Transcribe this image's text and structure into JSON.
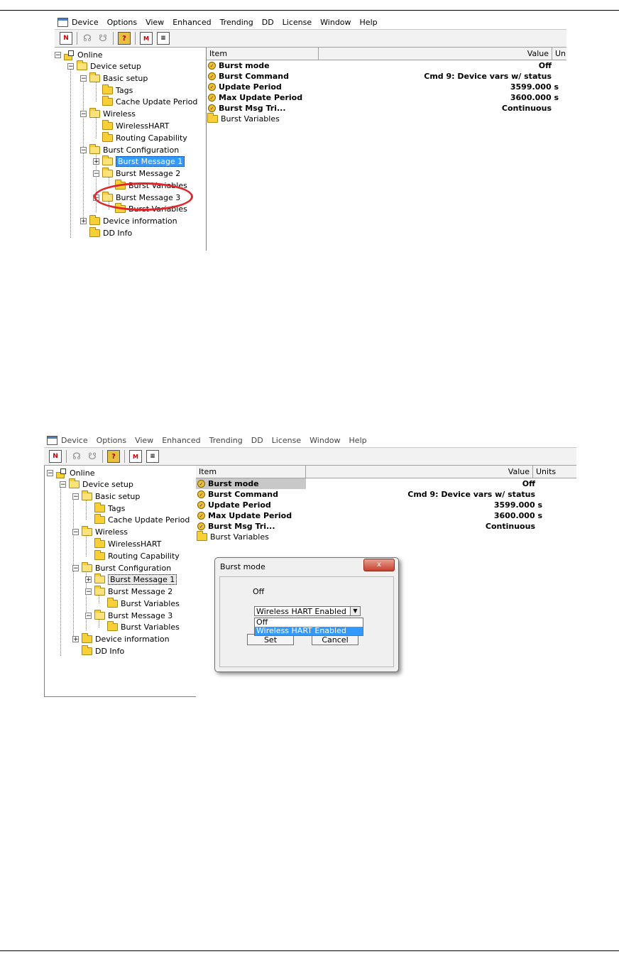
{
  "menu": [
    "Device",
    "Options",
    "View",
    "Enhanced",
    "Trending",
    "DD",
    "License",
    "Window",
    "Help"
  ],
  "toolbar_icons": [
    "new-icon",
    "connect-icon",
    "disconnect-icon",
    "help-icon",
    "methods-icon",
    "report-icon"
  ],
  "tree": {
    "online": "Online",
    "device_setup": "Device setup",
    "basic_setup": "Basic setup",
    "tags": "Tags",
    "cache_update_period": "Cache Update Period",
    "wireless": "Wireless",
    "wirelesshart": "WirelessHART",
    "routing_capability": "Routing Capability",
    "burst_configuration": "Burst Configuration",
    "burst_message_1": "Burst Message 1",
    "burst_message_2": "Burst Message 2",
    "burst_variables": "Burst Variables",
    "burst_message_3": "Burst Message 3",
    "device_information": "Device information",
    "dd_info": "DD Info"
  },
  "list": {
    "header_item": "Item",
    "header_value": "Value",
    "header_units_short": "Uni",
    "header_units": "Units",
    "rows": [
      {
        "item": "Burst mode",
        "value": "Off"
      },
      {
        "item": "Burst Command",
        "value": "Cmd 9: Device vars w/ status"
      },
      {
        "item": "Update Period",
        "value": "3599.000 s"
      },
      {
        "item": "Max Update Period",
        "value": "3600.000 s"
      },
      {
        "item": "Burst Msg Tri...",
        "value": "Continuous"
      }
    ],
    "folder_row": "Burst Variables"
  },
  "dialog": {
    "title": "Burst mode",
    "close": "x",
    "current_value": "Off",
    "selected": "Wireless HART Enabled",
    "options": [
      "Off",
      "Wireless HART Enabled"
    ],
    "set_label": "Set",
    "cancel_label": "Cancel"
  },
  "colors": {
    "selection": "#3399ff",
    "highlight_ring": "#e0262b",
    "folder": "#f7d038"
  }
}
